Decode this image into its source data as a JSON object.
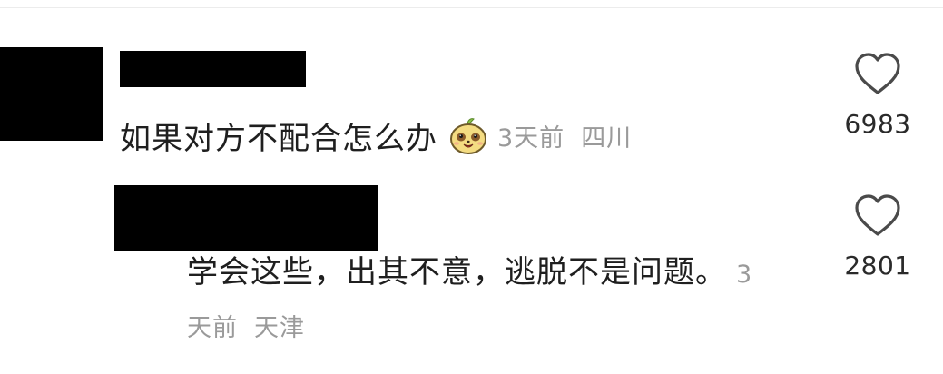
{
  "comments": [
    {
      "text": "如果对方不配合怎么办",
      "emoji": "smiling-mango-emoji",
      "time": "3天前",
      "location": "四川",
      "likes": "6983"
    },
    {
      "text": "学会这些，出其不意，逃脱不是问题。",
      "time": "3天前",
      "location": "天津",
      "likes": "2801"
    }
  ],
  "icons": {
    "like": "heart-outline-icon"
  },
  "colors": {
    "text": "#1f1f1f",
    "meta": "#9a9a9a",
    "heart_stroke": "#4a4a4a",
    "redaction": "#000000",
    "emoji_body": "#f4dc82"
  }
}
